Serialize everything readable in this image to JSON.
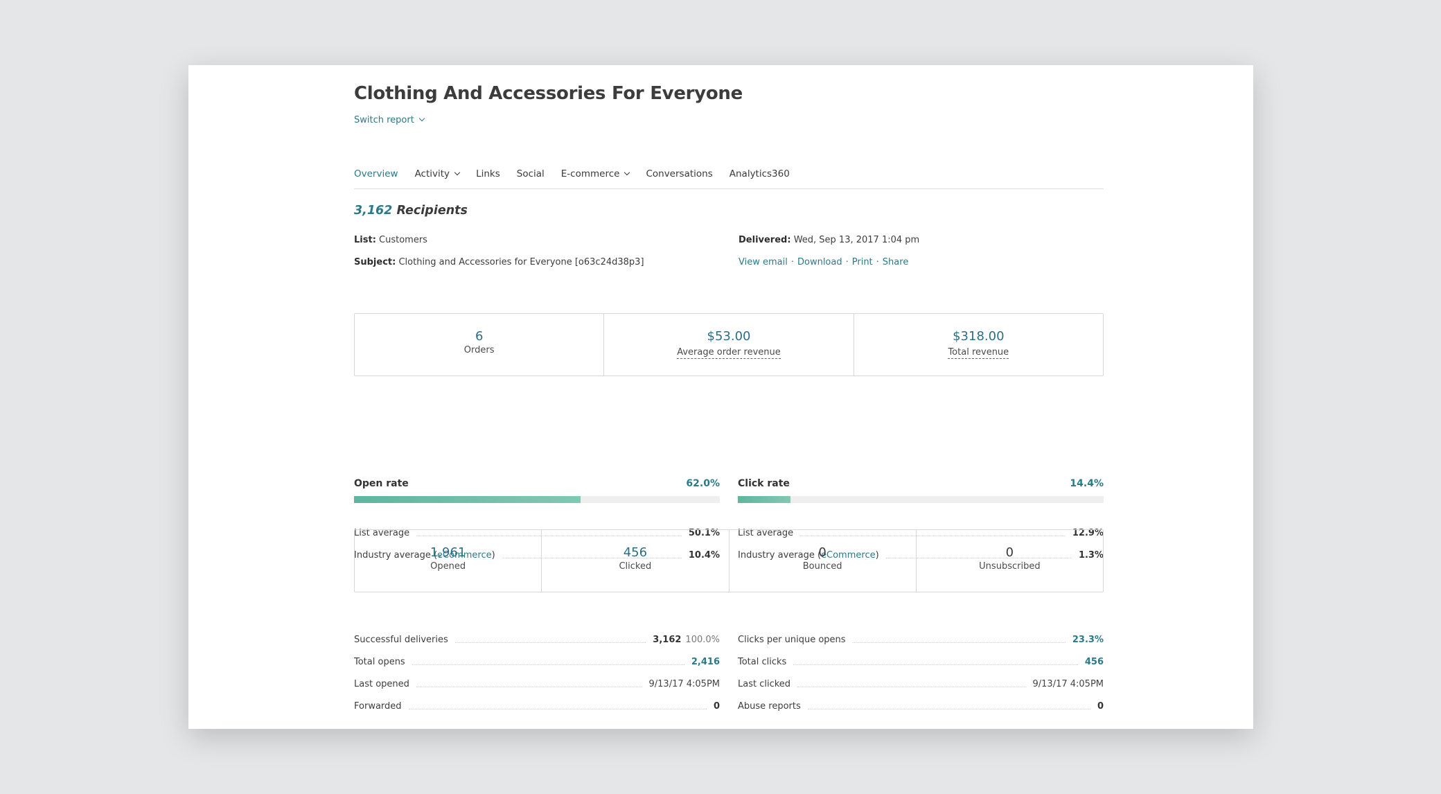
{
  "report": {
    "title": "Clothing And Accessories For Everyone",
    "switch_report": "Switch report"
  },
  "tabs": [
    {
      "label": "Overview",
      "active": true
    },
    {
      "label": "Activity",
      "dropdown": true
    },
    {
      "label": "Links"
    },
    {
      "label": "Social"
    },
    {
      "label": "E-commerce",
      "dropdown": true
    },
    {
      "label": "Conversations"
    },
    {
      "label": "Analytics360"
    }
  ],
  "summary": {
    "recipients_count": "3,162",
    "recipients_label": "Recipients",
    "list_label": "List:",
    "list_value": "Customers",
    "subject_label": "Subject:",
    "subject_value": "Clothing and Accessories for Everyone [o63c24d38p3]",
    "delivered_label": "Delivered:",
    "delivered_value": "Wed, Sep 13, 2017 1:04 pm",
    "actions": [
      "View email",
      "Download",
      "Print",
      "Share"
    ],
    "separator": "·"
  },
  "ecommerce": [
    {
      "value": "6",
      "label": "Orders"
    },
    {
      "value": "$53.00",
      "label": "Average order revenue"
    },
    {
      "value": "$318.00",
      "label": "Total revenue"
    }
  ],
  "rates": {
    "open": {
      "label": "Open rate",
      "value": "62.0%",
      "fill_percent": 62.0,
      "list_avg_label": "List average",
      "list_avg": "50.1%",
      "industry_label_pre": "Industry average (",
      "industry_link": "eCommerce",
      "industry_label_post": ")",
      "industry_avg": "10.4%"
    },
    "click": {
      "label": "Click rate",
      "value": "14.4%",
      "fill_percent": 14.4,
      "list_avg_label": "List average",
      "list_avg": "12.9%",
      "industry_label_pre": "Industry average (",
      "industry_link": "eCommerce",
      "industry_label_post": ")",
      "industry_avg": "1.3%"
    }
  },
  "activity": [
    {
      "value": "1,961",
      "label": "Opened"
    },
    {
      "value": "456",
      "label": "Clicked"
    },
    {
      "value": "0",
      "label": "Bounced"
    },
    {
      "value": "0",
      "label": "Unsubscribed"
    }
  ],
  "details_left": [
    {
      "label": "Successful deliveries",
      "value": "3,162",
      "extra": "100.0%"
    },
    {
      "label": "Total opens",
      "value": "2,416"
    },
    {
      "label": "Last opened",
      "value": "9/13/17 4:05PM"
    },
    {
      "label": "Forwarded",
      "value": "0"
    }
  ],
  "details_right": [
    {
      "label": "Clicks per unique opens",
      "value": "23.3%"
    },
    {
      "label": "Total clicks",
      "value": "456"
    },
    {
      "label": "Last clicked",
      "value": "9/13/17 4:05PM"
    },
    {
      "label": "Abuse reports",
      "value": "0"
    }
  ],
  "colors": {
    "accent": "#2a7a87",
    "bar_fill": "#6bbda8",
    "bar_track": "#efefef",
    "background": "#e5e6e8"
  }
}
